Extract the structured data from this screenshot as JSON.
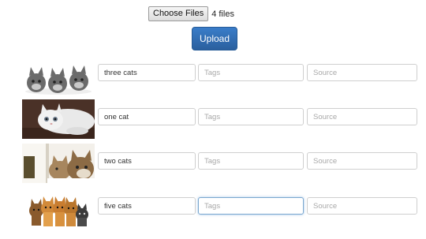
{
  "upload_form": {
    "choose_files_label": "Choose Files",
    "file_count_text": "4 files",
    "upload_label": "Upload"
  },
  "rows": [
    {
      "image": "three-kittens-photo",
      "name_value": "three cats",
      "tags_placeholder": "Tags",
      "source_placeholder": "Source"
    },
    {
      "image": "white-cat-lying-photo",
      "name_value": "one cat",
      "tags_placeholder": "Tags",
      "source_placeholder": "Source"
    },
    {
      "image": "two-cats-photo",
      "name_value": "two cats",
      "tags_placeholder": "Tags",
      "source_placeholder": "Source"
    },
    {
      "image": "five-kittens-photo",
      "name_value": "five cats",
      "tags_placeholder": "Tags",
      "source_placeholder": "Source",
      "tags_focused": true
    }
  ]
}
